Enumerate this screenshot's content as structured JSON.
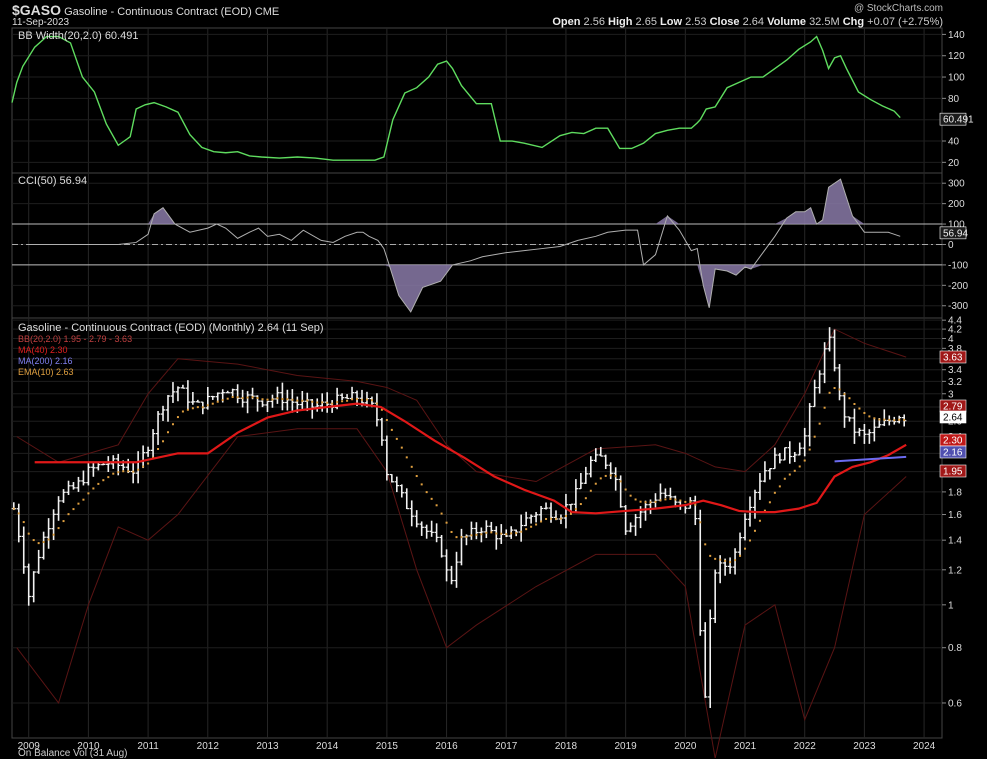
{
  "header": {
    "symbol": "$GASO",
    "description": "Gasoline - Continuous Contract (EOD)",
    "exchange": "CME",
    "date": "11-Sep-2023",
    "watermark": "@ StockCharts.com",
    "ohlc": {
      "open_label": "Open",
      "open": "2.56",
      "high_label": "High",
      "high": "2.65",
      "low_label": "Low",
      "low": "2.53",
      "close_label": "Close",
      "close": "2.64",
      "volume_label": "Volume",
      "volume": "32.5M",
      "chg_label": "Chg",
      "chg": "+0.07 (+2.75%)"
    }
  },
  "panels": {
    "bbwidth": {
      "label": "BB Width(20,2.0) 60.491",
      "value_tag": "60.491",
      "color": "#5fdc5f"
    },
    "cci": {
      "label": "CCI(50) 56.94",
      "value_tag": "56.94",
      "color": "#b0b0b0",
      "fill_color": "#8a7aa8"
    },
    "price": {
      "label": "Gasoline - Continuous Contract (EOD) (Monthly) 2.64 (11 Sep)",
      "legend": [
        {
          "text": "BB(20,2.0) 1.95 - 2.79 - 3.63",
          "color": "#a03030"
        },
        {
          "text": "MA(40) 2.30",
          "color": "#e02020"
        },
        {
          "text": "MA(200) 2.16",
          "color": "#7070e0"
        },
        {
          "text": "EMA(10) 2.63",
          "color": "#e0a040"
        }
      ],
      "tags": [
        {
          "text": "3.63",
          "value": 3.63,
          "color": "#a01818"
        },
        {
          "text": "2.79",
          "value": 2.79,
          "color": "#a01818"
        },
        {
          "text": "2.64",
          "value": 2.64,
          "color": "#ffffff"
        },
        {
          "text": "2.30",
          "value": 2.3,
          "color": "#c01818"
        },
        {
          "text": "2.16",
          "value": 2.16,
          "color": "#5050b0"
        },
        {
          "text": "1.95",
          "value": 1.95,
          "color": "#a01818"
        }
      ]
    },
    "obv_label": "On Balance Vol (31 Aug)"
  },
  "chart_data": [
    {
      "type": "line",
      "title": "BB Width(20,2.0)",
      "ylim": [
        10,
        146
      ],
      "yticks": [
        20,
        40,
        60,
        80,
        100,
        120,
        140
      ],
      "x": [
        2008.72,
        2008.8,
        2008.9,
        2009.1,
        2009.3,
        2009.5,
        2009.7,
        2009.9,
        2010.1,
        2010.3,
        2010.5,
        2010.7,
        2010.8,
        2010.95,
        2011.1,
        2011.3,
        2011.5,
        2011.7,
        2011.9,
        2012.1,
        2012.3,
        2012.5,
        2012.7,
        2012.9,
        2013.2,
        2013.5,
        2013.8,
        2014.1,
        2014.4,
        2014.6,
        2014.8,
        2014.95,
        2015.1,
        2015.3,
        2015.5,
        2015.7,
        2015.85,
        2016.0,
        2016.1,
        2016.25,
        2016.5,
        2016.75,
        2016.9,
        2017.1,
        2017.3,
        2017.6,
        2017.9,
        2018.1,
        2018.3,
        2018.5,
        2018.7,
        2018.9,
        2019.1,
        2019.3,
        2019.5,
        2019.7,
        2019.9,
        2020.1,
        2020.2,
        2020.25,
        2020.35,
        2020.5,
        2020.7,
        2020.9,
        2021.1,
        2021.3,
        2021.5,
        2021.7,
        2021.9,
        2022.1,
        2022.2,
        2022.3,
        2022.4,
        2022.5,
        2022.6,
        2022.7,
        2022.9,
        2023.1,
        2023.3,
        2023.5,
        2023.6
      ],
      "values": [
        76,
        95,
        110,
        128,
        138,
        138,
        132,
        100,
        86,
        56,
        36,
        44,
        70,
        74,
        76,
        72,
        67,
        46,
        34,
        30,
        29,
        30,
        26,
        25,
        24,
        25,
        24,
        22,
        22,
        22,
        22,
        25,
        60,
        85,
        90,
        100,
        112,
        115,
        108,
        92,
        75,
        75,
        40,
        40,
        38,
        34,
        45,
        48,
        47,
        52,
        52,
        33,
        33,
        38,
        47,
        50,
        52,
        52,
        57,
        60,
        70,
        72,
        90,
        95,
        100,
        100,
        108,
        116,
        126,
        133,
        138,
        125,
        108,
        118,
        120,
        108,
        86,
        79,
        73,
        68,
        62
      ]
    },
    {
      "type": "area",
      "title": "CCI(50)",
      "ylim": [
        -360,
        350
      ],
      "yticks": [
        -300,
        -200,
        -100,
        0,
        100,
        200,
        300
      ],
      "reference_lines": [
        100,
        -100
      ],
      "x": [
        2009.0,
        2009.5,
        2010.0,
        2010.5,
        2010.8,
        2011.0,
        2011.1,
        2011.25,
        2011.45,
        2011.7,
        2012.0,
        2012.15,
        2012.3,
        2012.5,
        2012.7,
        2012.85,
        2013.0,
        2013.2,
        2013.4,
        2013.6,
        2013.9,
        2014.1,
        2014.3,
        2014.5,
        2014.6,
        2014.7,
        2014.85,
        2014.95,
        2015.05,
        2015.2,
        2015.4,
        2015.6,
        2015.9,
        2016.1,
        2016.4,
        2016.6,
        2017.0,
        2017.3,
        2017.6,
        2017.9,
        2018.2,
        2018.5,
        2018.7,
        2019.0,
        2019.2,
        2019.3,
        2019.5,
        2019.7,
        2019.9,
        2020.1,
        2020.2,
        2020.3,
        2020.4,
        2020.5,
        2020.7,
        2020.85,
        2021.0,
        2021.1,
        2021.3,
        2021.5,
        2021.7,
        2021.85,
        2022.0,
        2022.1,
        2022.2,
        2022.3,
        2022.4,
        2022.6,
        2022.8,
        2023.0,
        2023.2,
        2023.4,
        2023.6
      ],
      "values": [
        0,
        0,
        0,
        0,
        10,
        50,
        150,
        180,
        100,
        60,
        80,
        100,
        80,
        30,
        60,
        80,
        40,
        50,
        20,
        70,
        20,
        10,
        40,
        60,
        60,
        40,
        20,
        -20,
        -110,
        -250,
        -330,
        -210,
        -180,
        -100,
        -80,
        -60,
        -40,
        -30,
        -20,
        -10,
        20,
        40,
        60,
        70,
        70,
        -100,
        -50,
        140,
        70,
        -30,
        -20,
        -200,
        -310,
        -120,
        -130,
        -150,
        -110,
        -120,
        -40,
        40,
        130,
        160,
        160,
        180,
        100,
        120,
        280,
        320,
        140,
        60,
        60,
        60,
        40
      ]
    },
    {
      "type": "ohlc",
      "title": "Gasoline - Continuous Contract (EOD) (Monthly)",
      "scale": "log",
      "ylim": [
        0.5,
        4.45
      ],
      "yticks": [
        0.6,
        0.8,
        1.0,
        1.2,
        1.4,
        1.6,
        1.8,
        2.0,
        2.2,
        2.4,
        2.6,
        2.8,
        3.0,
        3.2,
        3.4,
        3.6,
        3.8,
        4.0,
        4.2,
        4.4
      ],
      "x_years": [
        "2009",
        "2010",
        "2011",
        "2012",
        "2013",
        "2014",
        "2015",
        "2016",
        "2017",
        "2018",
        "2019",
        "2020",
        "2021",
        "2022",
        "2023",
        "2024"
      ],
      "close_anchor_x": [
        2008.75,
        2009.0,
        2009.2,
        2009.5,
        2009.8,
        2010.0,
        2010.3,
        2010.6,
        2010.8,
        2011.0,
        2011.3,
        2011.5,
        2011.8,
        2012.0,
        2012.3,
        2012.6,
        2012.9,
        2013.2,
        2013.5,
        2013.8,
        2014.2,
        2014.5,
        2014.6,
        2014.75,
        2014.9,
        2015.0,
        2015.3,
        2015.6,
        2015.9,
        2016.05,
        2016.25,
        2016.6,
        2017.0,
        2017.3,
        2017.6,
        2017.9,
        2018.2,
        2018.4,
        2018.6,
        2018.8,
        2019.0,
        2019.3,
        2019.6,
        2019.9,
        2020.1,
        2020.2,
        2020.25,
        2020.33,
        2020.5,
        2020.8,
        2021.0,
        2021.3,
        2021.6,
        2021.8,
        2022.0,
        2022.2,
        2022.4,
        2022.5,
        2022.6,
        2022.8,
        2023.0,
        2023.2,
        2023.4,
        2023.6,
        2023.7
      ],
      "close_anchor": [
        1.65,
        1.05,
        1.35,
        1.75,
        1.85,
        2.0,
        2.1,
        2.05,
        2.0,
        2.3,
        2.95,
        3.1,
        2.8,
        2.9,
        3.1,
        2.95,
        2.9,
        2.95,
        2.85,
        2.8,
        2.9,
        2.95,
        2.9,
        2.8,
        2.5,
        2.0,
        1.7,
        1.5,
        1.35,
        1.1,
        1.4,
        1.5,
        1.4,
        1.55,
        1.65,
        1.6,
        1.8,
        2.1,
        2.15,
        2.0,
        1.5,
        1.65,
        1.8,
        1.65,
        1.7,
        1.5,
        0.9,
        0.6,
        1.2,
        1.25,
        1.6,
        2.0,
        2.2,
        2.2,
        2.4,
        3.2,
        4.0,
        3.5,
        2.8,
        2.5,
        2.4,
        2.5,
        2.6,
        2.7,
        2.64
      ],
      "ma40_x": [
        2009.1,
        2010.0,
        2010.8,
        2011.5,
        2012.0,
        2012.5,
        2013.0,
        2013.5,
        2014.0,
        2014.5,
        2014.9,
        2015.3,
        2015.8,
        2016.3,
        2016.8,
        2017.3,
        2017.8,
        2018.1,
        2018.5,
        2019.0,
        2019.5,
        2020.0,
        2020.3,
        2020.6,
        2020.9,
        2021.2,
        2021.5,
        2021.9,
        2022.2,
        2022.5,
        2022.8,
        2023.1,
        2023.4,
        2023.7
      ],
      "ma40": [
        2.1,
        2.1,
        2.1,
        2.2,
        2.2,
        2.45,
        2.65,
        2.75,
        2.8,
        2.85,
        2.8,
        2.6,
        2.35,
        2.15,
        1.95,
        1.82,
        1.72,
        1.62,
        1.61,
        1.63,
        1.65,
        1.68,
        1.72,
        1.68,
        1.63,
        1.62,
        1.62,
        1.65,
        1.7,
        1.95,
        2.05,
        2.1,
        2.18,
        2.3
      ],
      "ma200_x": [
        2022.5,
        2023.7
      ],
      "ma200": [
        2.11,
        2.16
      ],
      "bb_upper_x": [
        2008.8,
        2009.5,
        2010.5,
        2011.0,
        2011.5,
        2012.5,
        2013.5,
        2014.5,
        2015.0,
        2015.5,
        2016.0,
        2016.5,
        2017.5,
        2018.5,
        2019.5,
        2020.0,
        2020.5,
        2021.0,
        2021.5,
        2022.0,
        2022.5,
        2023.0,
        2023.7
      ],
      "bb_upper": [
        2.4,
        2.1,
        2.3,
        3.0,
        3.6,
        3.5,
        3.3,
        3.2,
        3.1,
        2.9,
        2.3,
        2.0,
        1.9,
        2.25,
        2.3,
        2.2,
        2.05,
        2.0,
        2.3,
        3.0,
        4.2,
        3.9,
        3.63
      ],
      "bb_lower_x": [
        2008.8,
        2009.5,
        2010.0,
        2010.5,
        2011.0,
        2011.5,
        2012.5,
        2013.5,
        2014.5,
        2015.0,
        2015.5,
        2016.0,
        2016.5,
        2017.5,
        2018.5,
        2019.5,
        2020.0,
        2020.5,
        2021.0,
        2021.5,
        2022.0,
        2022.5,
        2023.0,
        2023.7
      ],
      "bb_lower": [
        0.8,
        0.6,
        1.0,
        1.5,
        1.4,
        1.6,
        2.4,
        2.5,
        2.5,
        2.0,
        1.2,
        0.8,
        0.9,
        1.1,
        1.3,
        1.3,
        1.1,
        0.45,
        0.9,
        1.0,
        0.55,
        0.8,
        1.6,
        1.95
      ]
    }
  ]
}
